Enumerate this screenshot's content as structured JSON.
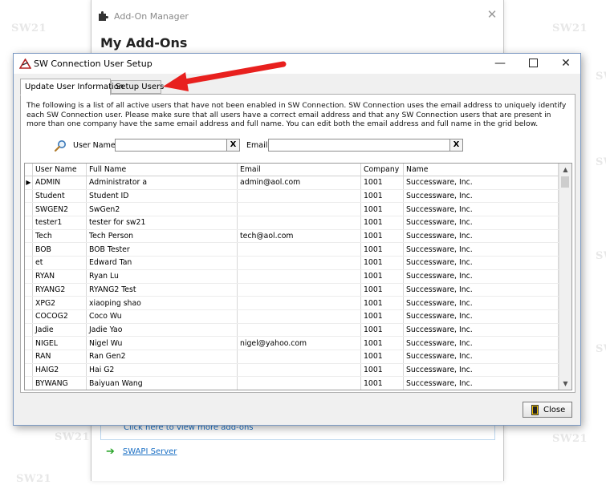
{
  "watermark": "SW21",
  "background_window": {
    "title": "Add-On Manager",
    "heading": "My Add-Ons",
    "more_link": "Click here to view more add-ons",
    "server_link": "SWAPI Server"
  },
  "dialog": {
    "title": "SW Connection User Setup",
    "tabs": [
      {
        "label": "Update User Information",
        "active": true
      },
      {
        "label": "Setup Users",
        "active": false
      }
    ],
    "description": "The following is a list of all active users that have not been enabled in SW Connection.  SW Connection uses the email address to uniquely identify each SW Connection user.  Please make sure that all users have a correct email address and that any SW Connection users that are present in more than one company have the same email address and full name.  You can edit both the email address and full name in the grid below.",
    "filters": {
      "username_label": "User Name",
      "username_value": "",
      "email_label": "Email",
      "email_value": "",
      "clear_label": "X"
    },
    "grid": {
      "columns": [
        "User Name",
        "Full Name",
        "Email",
        "Company",
        "Name"
      ],
      "rows": [
        [
          "ADMIN",
          "Administrator a",
          "admin@aol.com",
          "1001",
          "Successware, Inc."
        ],
        [
          "Student",
          "Student ID",
          "",
          "1001",
          "Successware, Inc."
        ],
        [
          "SWGEN2",
          "SwGen2",
          "",
          "1001",
          "Successware, Inc."
        ],
        [
          "tester1",
          "tester for sw21",
          "",
          "1001",
          "Successware, Inc."
        ],
        [
          "Tech",
          "Tech Person",
          "tech@aol.com",
          "1001",
          "Successware, Inc."
        ],
        [
          "BOB",
          "BOB Tester",
          "",
          "1001",
          "Successware, Inc."
        ],
        [
          "et",
          "Edward Tan",
          "",
          "1001",
          "Successware, Inc."
        ],
        [
          "RYAN",
          "Ryan Lu",
          "",
          "1001",
          "Successware, Inc."
        ],
        [
          "RYANG2",
          "RYANG2 Test",
          "",
          "1001",
          "Successware, Inc."
        ],
        [
          "XPG2",
          "xiaoping shao",
          "",
          "1001",
          "Successware, Inc."
        ],
        [
          "COCOG2",
          "Coco Wu",
          "",
          "1001",
          "Successware, Inc."
        ],
        [
          "Jadie",
          "Jadie Yao",
          "",
          "1001",
          "Successware, Inc."
        ],
        [
          "NIGEL",
          "Nigel Wu",
          "nigel@yahoo.com",
          "1001",
          "Successware, Inc."
        ],
        [
          "RAN",
          "Ran Gen2",
          "",
          "1001",
          "Successware, Inc."
        ],
        [
          "HAIG2",
          "Hai G2",
          "",
          "1001",
          "Successware, Inc."
        ],
        [
          "BYWANG",
          "Baiyuan Wang",
          "",
          "1001",
          "Successware, Inc."
        ]
      ],
      "current_row_marker": "▶"
    },
    "close_label": "Close"
  },
  "colors": {
    "accent_red": "#e8201e",
    "link_blue": "#1a6fc4",
    "arrow_green": "#2aa52a"
  }
}
